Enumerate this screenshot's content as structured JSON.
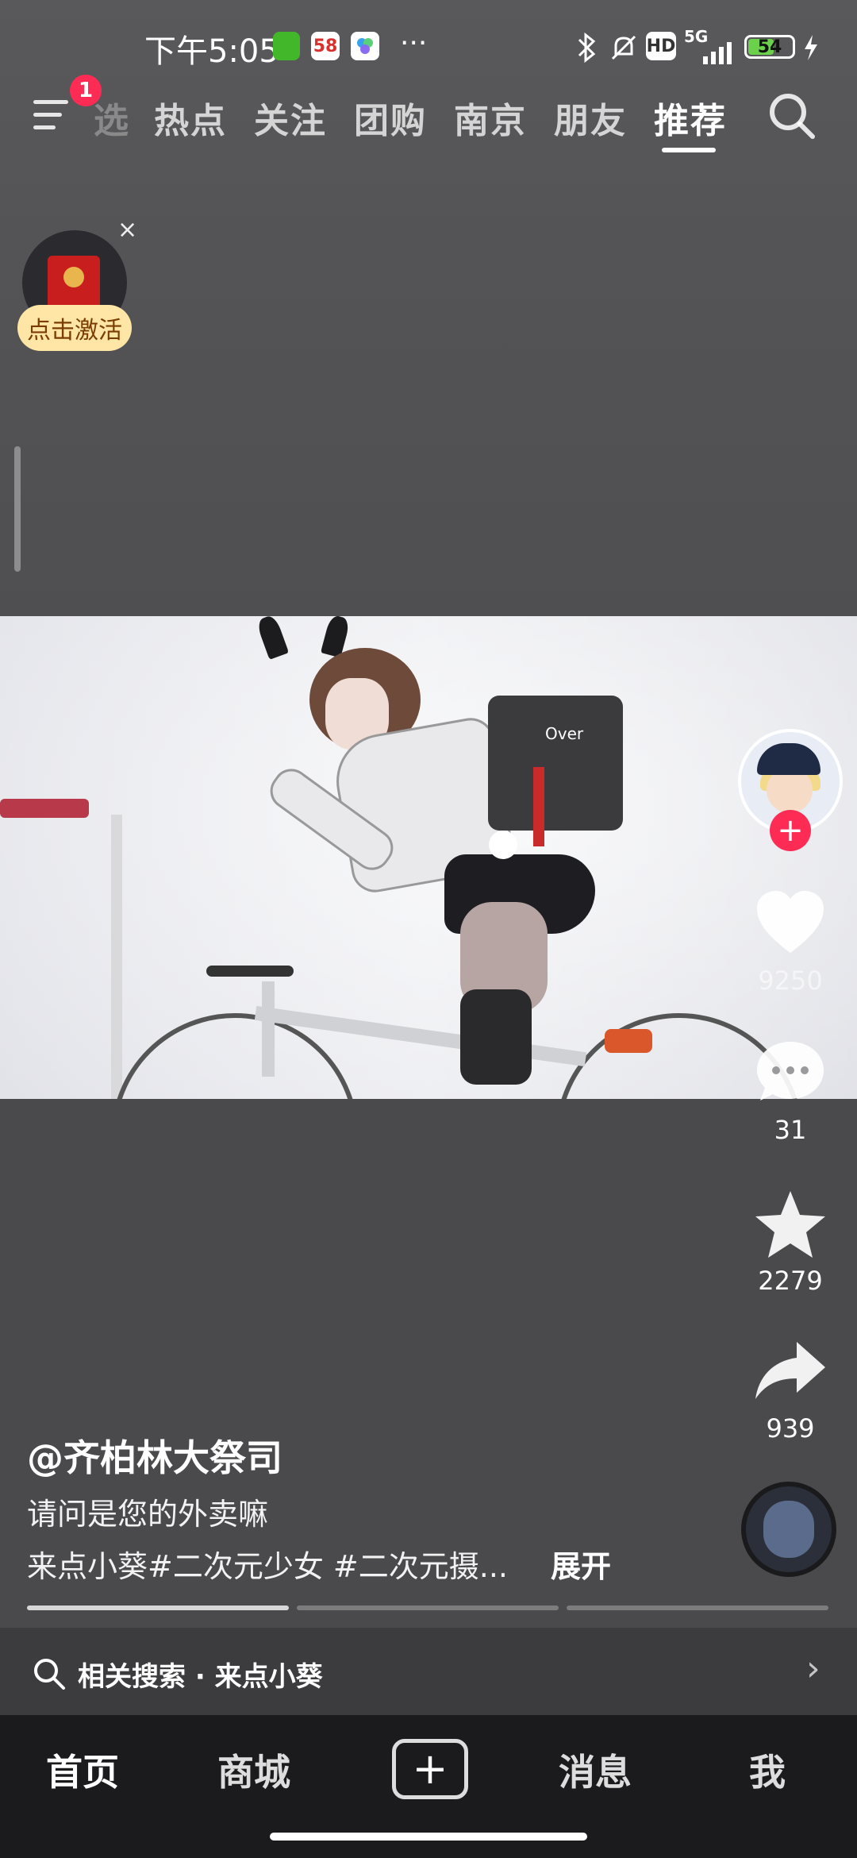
{
  "status_bar": {
    "time": "下午5:05",
    "network": "5G",
    "battery": "54",
    "hd_label": "HD",
    "app58_label": "58",
    "more": "···"
  },
  "top_nav": {
    "badge_count": "1",
    "tabs": [
      {
        "label": "热点"
      },
      {
        "label": "关注"
      },
      {
        "label": "团购"
      },
      {
        "label": "南京"
      },
      {
        "label": "朋友"
      },
      {
        "label": "推荐"
      }
    ],
    "partial_tab": "选",
    "active_tab": "推荐"
  },
  "promo": {
    "label": "点击激活",
    "close": "×"
  },
  "video": {
    "backpack_text": "Over"
  },
  "actions": {
    "likes": "9250",
    "comments": "31",
    "favorites": "2279",
    "shares": "939"
  },
  "post": {
    "author": "@齐柏林大祭司",
    "description": "请问是您的外卖嘛",
    "tags_line": "来点小葵#二次元少女 #二次元摄...",
    "expand": "展开"
  },
  "related_search": {
    "label": "相关搜索 · 来点小葵"
  },
  "bottom_nav": {
    "home": "首页",
    "mall": "商城",
    "messages": "消息",
    "me": "我"
  },
  "colors": {
    "accent": "#fe2c55",
    "promo_bg": "#ffe6a6"
  }
}
